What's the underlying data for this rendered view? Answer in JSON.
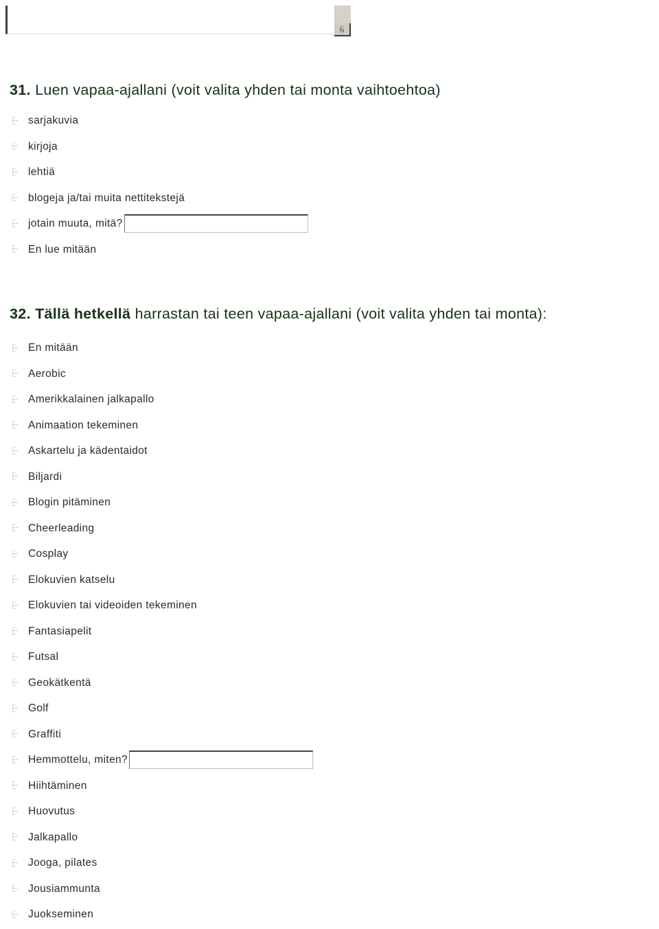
{
  "header": {
    "page_number": "6"
  },
  "questions": [
    {
      "number": "31.",
      "emphasis": "",
      "text": "Luen vapaa-ajallani (voit valita yhden tai monta vaihtoehtoa)",
      "options": [
        {
          "label": "sarjakuvia"
        },
        {
          "label": "kirjoja"
        },
        {
          "label": "lehtiä"
        },
        {
          "label": "blogeja ja/tai muita nettitekstejä"
        },
        {
          "label": "jotain muuta, mitä?",
          "input": {
            "value": "",
            "placeholder": ""
          }
        },
        {
          "label": "En lue mitään"
        }
      ]
    },
    {
      "number": "32.",
      "emphasis": "Tällä hetkellä",
      "text": " harrastan tai teen vapaa-ajallani (voit valita yhden tai monta):",
      "options": [
        {
          "label": "En mitään"
        },
        {
          "label": "Aerobic"
        },
        {
          "label": "Amerikkalainen jalkapallo"
        },
        {
          "label": "Animaation tekeminen"
        },
        {
          "label": "Askartelu ja kädentaidot"
        },
        {
          "label": "Biljardi"
        },
        {
          "label": "Blogin pitäminen"
        },
        {
          "label": "Cheerleading"
        },
        {
          "label": "Cosplay"
        },
        {
          "label": "Elokuvien katselu"
        },
        {
          "label": "Elokuvien tai videoiden tekeminen"
        },
        {
          "label": "Fantasiapelit"
        },
        {
          "label": "Futsal"
        },
        {
          "label": "Geokätkentä"
        },
        {
          "label": "Golf"
        },
        {
          "label": "Graffiti"
        },
        {
          "label": "Hemmottelu, miten?",
          "input": {
            "value": "",
            "placeholder": ""
          }
        },
        {
          "label": "Hiihtäminen"
        },
        {
          "label": "Huovutus"
        },
        {
          "label": "Jalkapallo"
        },
        {
          "label": "Jooga, pilates"
        },
        {
          "label": "Jousiammunta"
        },
        {
          "label": "Juokseminen"
        }
      ]
    }
  ],
  "colors": {
    "heading": "#163316",
    "body_text": "#2a2a2a",
    "page_box": "#d6d2ca"
  }
}
